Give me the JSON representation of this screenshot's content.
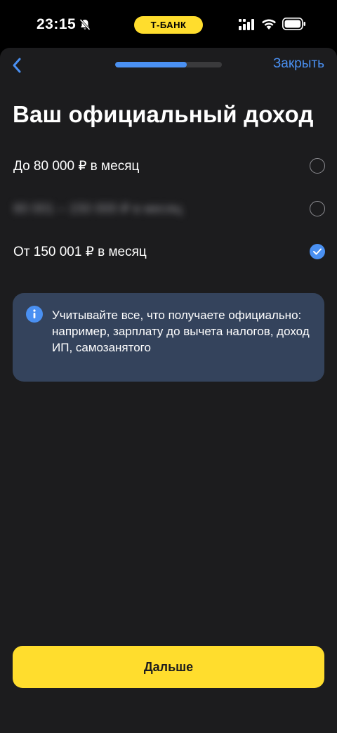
{
  "status_bar": {
    "time": "23:15",
    "bank_badge": "Т-БАНК",
    "icons": [
      "bell-slash-icon",
      "signal-icon",
      "wifi-icon",
      "battery-icon"
    ]
  },
  "header": {
    "back_icon": "chevron-left-icon",
    "progress": 0.67,
    "close_label": "Закрыть"
  },
  "title": "Ваш официальный доход",
  "options": [
    {
      "label": "До 80 000 ₽ в месяц",
      "selected": false
    },
    {
      "label": "80 001 – 150 000 ₽ в месяц",
      "selected": false,
      "obscured": true
    },
    {
      "label": "От 150 001 ₽ в месяц",
      "selected": true
    }
  ],
  "info": {
    "icon": "info-icon",
    "text": "Учитывайте все, что получаете официально: например, зарплату до вычета налогов, доход ИП, самозанятого"
  },
  "footer": {
    "next_label": "Дальше"
  },
  "colors": {
    "accent": "#4a90f2",
    "brand_yellow": "#ffdd2d",
    "sheet_bg": "#1c1c1e",
    "info_bg": "#34435c"
  }
}
